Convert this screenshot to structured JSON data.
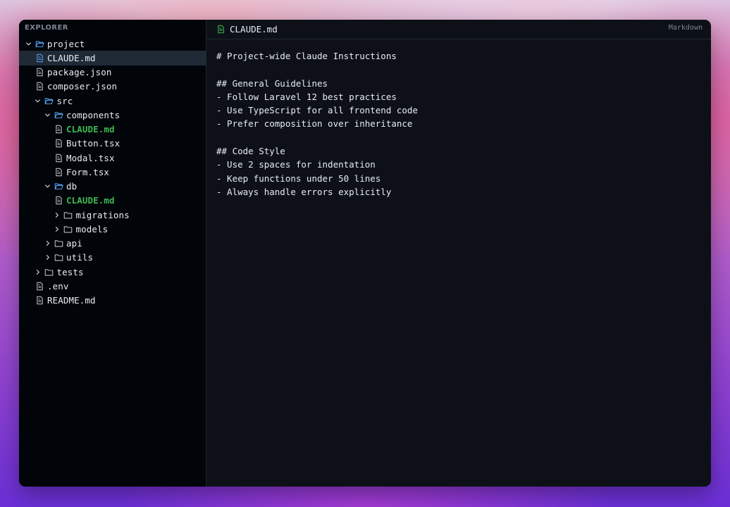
{
  "explorer": {
    "title": "EXPLORER",
    "tree": [
      {
        "label": "project",
        "type": "folder",
        "depth": 0,
        "expanded": true
      },
      {
        "label": "CLAUDE.md",
        "type": "file",
        "depth": 1,
        "selected": true
      },
      {
        "label": "package.json",
        "type": "file",
        "depth": 1
      },
      {
        "label": "composer.json",
        "type": "file",
        "depth": 1
      },
      {
        "label": "src",
        "type": "folder",
        "depth": 1,
        "expanded": true
      },
      {
        "label": "components",
        "type": "folder",
        "depth": 2,
        "expanded": true
      },
      {
        "label": "CLAUDE.md",
        "type": "file",
        "depth": 3,
        "highlight": true
      },
      {
        "label": "Button.tsx",
        "type": "file",
        "depth": 3
      },
      {
        "label": "Modal.tsx",
        "type": "file",
        "depth": 3
      },
      {
        "label": "Form.tsx",
        "type": "file",
        "depth": 3
      },
      {
        "label": "db",
        "type": "folder",
        "depth": 2,
        "expanded": true
      },
      {
        "label": "CLAUDE.md",
        "type": "file",
        "depth": 3,
        "highlight": true
      },
      {
        "label": "migrations",
        "type": "folder",
        "depth": 3,
        "expanded": false
      },
      {
        "label": "models",
        "type": "folder",
        "depth": 3,
        "expanded": false
      },
      {
        "label": "api",
        "type": "folder",
        "depth": 2,
        "expanded": false
      },
      {
        "label": "utils",
        "type": "folder",
        "depth": 2,
        "expanded": false
      },
      {
        "label": "tests",
        "type": "folder",
        "depth": 1,
        "expanded": false
      },
      {
        "label": ".env",
        "type": "file",
        "depth": 1
      },
      {
        "label": "README.md",
        "type": "file",
        "depth": 1
      }
    ]
  },
  "editor": {
    "tab": {
      "label": "CLAUDE.md",
      "icon": "file-icon"
    },
    "language": "Markdown",
    "lines": [
      "# Project-wide Claude Instructions",
      "",
      "## General Guidelines",
      "- Follow Laravel 12 best practices",
      "- Use TypeScript for all frontend code",
      "- Prefer composition over inheritance",
      "",
      "## Code Style",
      "- Use 2 spaces for indentation",
      "- Keep functions under 50 lines",
      "- Always handle errors explicitly"
    ]
  },
  "colors": {
    "highlight_file": "#3fb950",
    "folder_icon": "#58a6ff",
    "file_icon": "#c9d1d9"
  }
}
